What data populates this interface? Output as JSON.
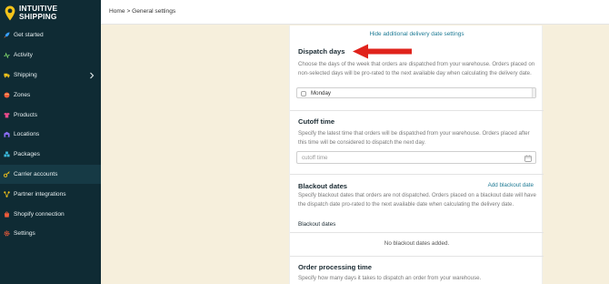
{
  "brand": {
    "line1": "INTUITIVE",
    "line2": "SHIPPING"
  },
  "sidebar": {
    "items": [
      {
        "label": "Get started",
        "icon": "rocket-icon"
      },
      {
        "label": "Activity",
        "icon": "activity-icon"
      },
      {
        "label": "Shipping",
        "icon": "shipping-icon"
      },
      {
        "label": "Zones",
        "icon": "zones-icon"
      },
      {
        "label": "Products",
        "icon": "shirt-icon"
      },
      {
        "label": "Locations",
        "icon": "warehouse-icon"
      },
      {
        "label": "Packages",
        "icon": "packages-icon"
      },
      {
        "label": "Carrier accounts",
        "icon": "key-icon"
      },
      {
        "label": "Partner integrations",
        "icon": "integrations-icon"
      },
      {
        "label": "Shopify connection",
        "icon": "shopify-icon"
      },
      {
        "label": "Settings",
        "icon": "gear-icon"
      }
    ]
  },
  "breadcrumb": {
    "home": "Home",
    "separator": ">",
    "current": "General settings"
  },
  "panel": {
    "hide_link": "Hide additional delivery date settings",
    "dispatch": {
      "title": "Dispatch days",
      "description": "Choose the days of the week that orders are dispatched from your warehouse. Orders placed on non-selected days will be pro-rated to the next available day when calculating the delivery date.",
      "selected_day": "Monday"
    },
    "cutoff": {
      "title": "Cutoff time",
      "description": "Specify the latest time that orders will be dispatched from your warehouse. Orders placed after this time will be considered to dispatch the next day.",
      "placeholder": "cutoff time"
    },
    "blackout": {
      "title": "Blackout dates",
      "add_link": "Add blackout date",
      "description": "Specify blackout dates that orders are not dispatched. Orders placed on a blackout date will have the dispatch date pro-rated to the next available date when calculating the delivery date.",
      "list_label": "Blackout dates",
      "empty_text": "No blackout dates added."
    },
    "processing": {
      "title": "Order processing time",
      "description": "Specify how many days it takes to dispatch an order from your warehouse."
    }
  },
  "colors": {
    "sidebar_bg": "#0f2b34",
    "page_bg": "#f6efdc",
    "link": "#1e7a94",
    "arrow": "#e0231c",
    "logo": "#f2c31a"
  }
}
